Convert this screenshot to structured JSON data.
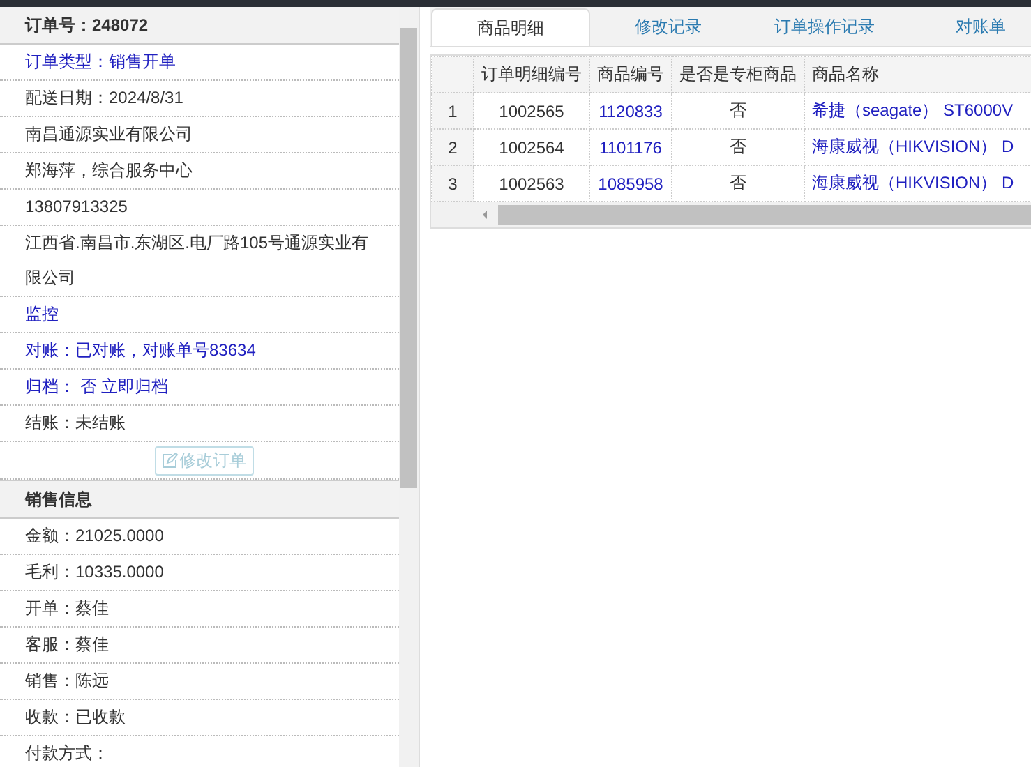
{
  "order_panel": {
    "title": "订单号：248072",
    "rows": [
      {
        "kind": "link",
        "text": "订单类型：销售开单"
      },
      {
        "kind": "text",
        "text": "配送日期：2024/8/31"
      },
      {
        "kind": "text",
        "text": "南昌通源实业有限公司"
      },
      {
        "kind": "text",
        "text": "郑海萍，综合服务中心"
      },
      {
        "kind": "text",
        "text": "13807913325"
      },
      {
        "kind": "text",
        "text": "江西省.南昌市.东湖区.电厂路105号通源实业有限公司"
      },
      {
        "kind": "link",
        "text": "监控"
      },
      {
        "kind": "link",
        "text": "对账：已对账，对账单号83634"
      },
      {
        "kind": "link",
        "text": "归档： 否 立即归档"
      },
      {
        "kind": "text",
        "text": "结账：未结账"
      }
    ],
    "edit_button": {
      "label": "修改订单",
      "disabled": true
    }
  },
  "sales_panel": {
    "title": "销售信息",
    "rows": [
      {
        "kind": "text",
        "text": "金额：21025.0000"
      },
      {
        "kind": "text",
        "text": "毛利：10335.0000"
      },
      {
        "kind": "text",
        "text": "开单：蔡佳"
      },
      {
        "kind": "text",
        "text": "客服：蔡佳"
      },
      {
        "kind": "text",
        "text": "销售：陈远"
      },
      {
        "kind": "text",
        "text": "收款：已收款"
      },
      {
        "kind": "text",
        "text": "付款方式："
      }
    ]
  },
  "tabs": [
    {
      "label": "商品明细",
      "selected": true
    },
    {
      "label": "修改记录",
      "selected": false
    },
    {
      "label": "订单操作记录",
      "selected": false
    },
    {
      "label": "对账单",
      "selected": false
    }
  ],
  "table": {
    "columns": [
      "订单明细编号",
      "商品编号",
      "是否是专柜商品",
      "商品名称"
    ],
    "rows": [
      {
        "index": "1",
        "detail_no": "1002565",
        "product_no": "1120833",
        "counter": "否",
        "name": "希捷（seagate） ST6000V"
      },
      {
        "index": "2",
        "detail_no": "1002564",
        "product_no": "1101176",
        "counter": "否",
        "name": "海康威视（HIKVISION） D"
      },
      {
        "index": "3",
        "detail_no": "1002563",
        "product_no": "1085958",
        "counter": "否",
        "name": "海康威视（HIKVISION） D"
      }
    ]
  }
}
